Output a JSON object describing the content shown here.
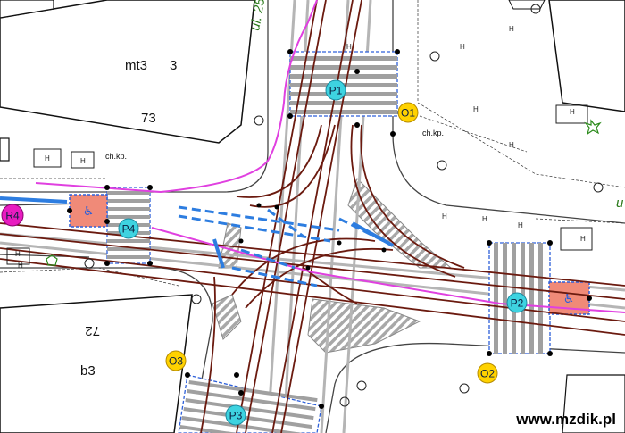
{
  "buildings": {
    "top_left_name": "mt3",
    "top_left_number": "3",
    "top_left_extra": "73",
    "bottom_left_name": "b3",
    "bottom_left_number": "72"
  },
  "street_labels": {
    "top": "ul. 25",
    "right": "u"
  },
  "small_labels": {
    "chkp_left": "ch.kp.",
    "chkp_right": "ch.kp."
  },
  "crossings": [
    {
      "id": "P1",
      "label": "P1"
    },
    {
      "id": "P2",
      "label": "P2"
    },
    {
      "id": "P3",
      "label": "P3"
    },
    {
      "id": "P4",
      "label": "P4"
    }
  ],
  "signals": [
    {
      "id": "O1",
      "label": "O1"
    },
    {
      "id": "O2",
      "label": "O2"
    },
    {
      "id": "O3",
      "label": "O3"
    }
  ],
  "stops": [
    {
      "id": "R4",
      "label": "R4"
    }
  ],
  "watermark": "www.mzdik.pl",
  "colors": {
    "tram_track": "#6b1a0f",
    "bike_path": "#e040e0",
    "crossing_marker": "#3ed3e0",
    "signal_marker": "#ffd200",
    "stop_marker": "#e81cc0",
    "island": "#f08a78",
    "lane_dash": "#2d7de0"
  }
}
